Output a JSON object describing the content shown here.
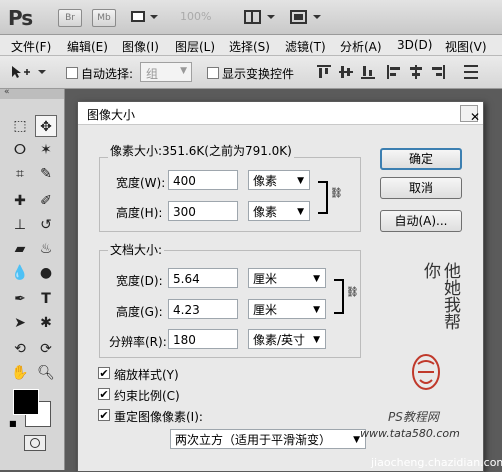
{
  "app": {
    "logo": "Ps",
    "btn_br": "Br",
    "btn_mb": "Mb",
    "zoom": "100%"
  },
  "menu": [
    "文件(F)",
    "编辑(E)",
    "图像(I)",
    "图层(L)",
    "选择(S)",
    "滤镜(T)",
    "分析(A)",
    "3D(D)",
    "视图(V)"
  ],
  "options": {
    "auto_select_label": "自动选择:",
    "auto_select_value": "组",
    "show_transform_label": "显示变换控件"
  },
  "dialog": {
    "title": "图像大小",
    "pixel_dims_label": "像素大小:351.6K(之前为791.0K)",
    "width_label": "宽度(W):",
    "width_value": "400",
    "width_unit": "像素",
    "height_label": "高度(H):",
    "height_value": "300",
    "height_unit": "像素",
    "doc_size_label": "文档大小:",
    "doc_width_label": "宽度(D):",
    "doc_width_value": "5.64",
    "doc_width_unit": "厘米",
    "doc_height_label": "高度(G):",
    "doc_height_value": "4.23",
    "doc_height_unit": "厘米",
    "resolution_label": "分辨率(R):",
    "resolution_value": "180",
    "resolution_unit": "像素/英寸",
    "scale_styles_label": "缩放样式(Y)",
    "constrain_label": "约束比例(C)",
    "resample_label": "重定图像像素(I):",
    "resample_method": "两次立方（适用于平滑渐变）",
    "ok_label": "确定",
    "cancel_label": "取消",
    "auto_label": "自动(A)..."
  },
  "watermark": {
    "signature": "他她我帮你",
    "brand": "PS教程网",
    "site": "www.tata580.com",
    "footer": "jiaocheng.chazidian.com"
  }
}
